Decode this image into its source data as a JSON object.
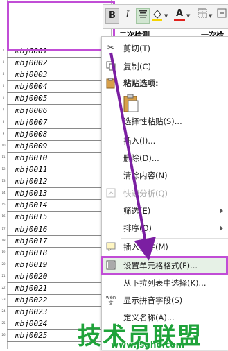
{
  "sheet": {
    "column_header_partial": "二次检测",
    "column_header_partial_right": "一次检",
    "rows": [
      "mbj0001",
      "mbj0002",
      "mbj0003",
      "mbj0004",
      "mbj0005",
      "mbj0006",
      "mbj0007",
      "mbj0008",
      "mbj0009",
      "mbj0010",
      "mbj0011",
      "mbj0012",
      "mbj0013",
      "mbj0014",
      "mbj0015",
      "mbj0016",
      "mbj0017",
      "mbj0018",
      "mbj0019",
      "mbj0020",
      "mbj0021",
      "mbj0022",
      "mbj0023",
      "mbj0024",
      "mbj0025"
    ]
  },
  "mini_toolbar": {
    "bold": "B",
    "italic": "I",
    "align_icon": "align-center-icon",
    "fill_icon": "fill-color-icon",
    "font_color_icon": "font-color-icon",
    "font_color_label": "A",
    "border_icon": "border-icon",
    "merge_icon": "merge-icon"
  },
  "context_menu": {
    "cut": "剪切(T)",
    "copy": "复制(C)",
    "paste_options": "粘贴选项:",
    "paste_special": "选择性粘贴(S)...",
    "insert": "插入(I)...",
    "delete": "删除(D)...",
    "clear": "清除内容(N)",
    "quick_analysis": "快速分析(Q)",
    "filter": "筛选(E)",
    "sort": "排序(O)",
    "insert_comment": "插入批注(M)",
    "format_cells": "设置单元格格式(F)...",
    "pick_from_list": "从下拉列表中选择(K)...",
    "phonetic": "显示拼音字段(S)",
    "phonetic_icon_text": "wén",
    "define_name": "定义名称(A)..."
  },
  "watermark": {
    "text": "技术员联盟",
    "url": "www.jsgho.com"
  },
  "colors": {
    "highlight_box": "#c14dd6",
    "watermark": "#1fa33a",
    "arrow": "#7b1fa2"
  }
}
